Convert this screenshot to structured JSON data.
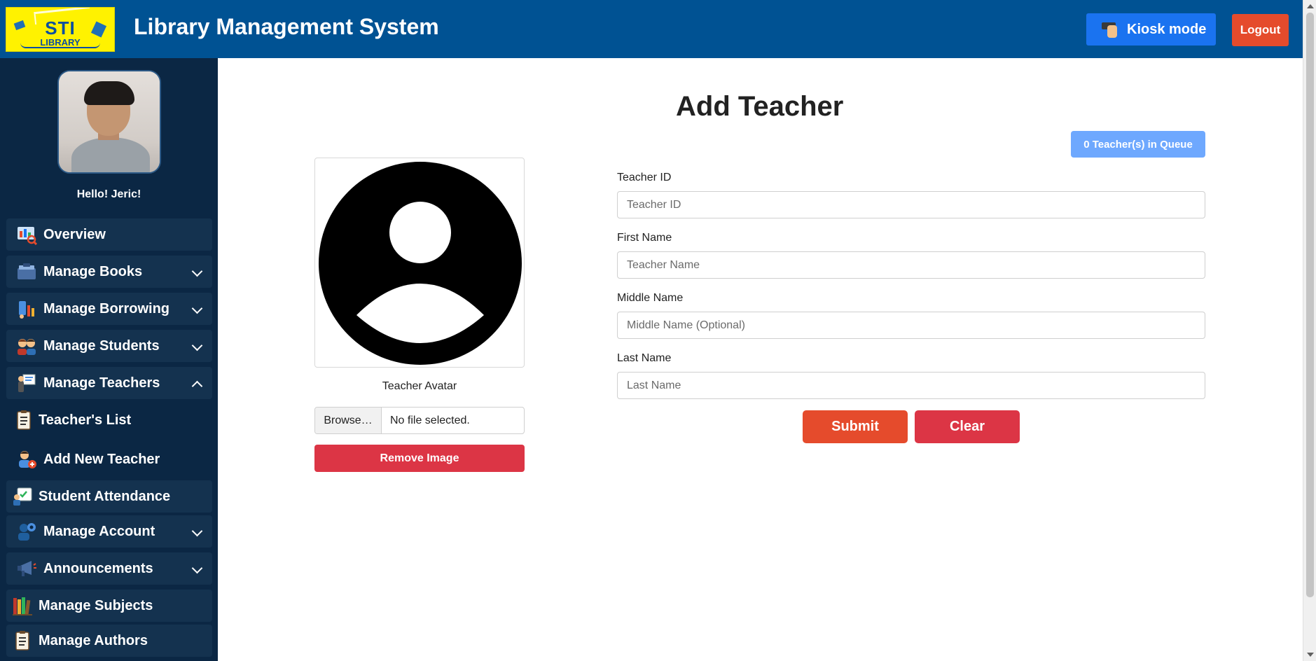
{
  "header": {
    "logo_text_main": "STI",
    "logo_text_sub": "LIBRARY",
    "title": "Library Management System",
    "kiosk_label": "Kiosk mode",
    "logout_label": "Logout"
  },
  "sidebar": {
    "greeting": "Hello! Jeric!",
    "items": [
      {
        "label": "Overview",
        "icon": "overview-icon",
        "expandable": false
      },
      {
        "label": "Manage Books",
        "icon": "books-icon",
        "expandable": true,
        "expanded": false
      },
      {
        "label": "Manage Borrowing",
        "icon": "borrowing-icon",
        "expandable": true,
        "expanded": false
      },
      {
        "label": "Manage Students",
        "icon": "students-icon",
        "expandable": true,
        "expanded": false
      },
      {
        "label": "Manage Teachers",
        "icon": "teachers-icon",
        "expandable": true,
        "expanded": true
      },
      {
        "label": "Teacher's List",
        "icon": "list-icon",
        "expandable": false
      },
      {
        "label": "Add New Teacher",
        "icon": "add-teacher-icon",
        "expandable": false
      },
      {
        "label": "Student Attendance",
        "icon": "attendance-icon",
        "expandable": false
      },
      {
        "label": "Manage Account",
        "icon": "account-icon",
        "expandable": true,
        "expanded": false
      },
      {
        "label": "Announcements",
        "icon": "megaphone-icon",
        "expandable": true,
        "expanded": false
      },
      {
        "label": "Manage Subjects",
        "icon": "subjects-icon",
        "expandable": false
      },
      {
        "label": "Manage Authors",
        "icon": "authors-icon",
        "expandable": false
      }
    ]
  },
  "main": {
    "page_title": "Add Teacher",
    "queue_badge": "0 Teacher(s) in Queue",
    "avatar_caption": "Teacher Avatar",
    "file_button": "Browse…",
    "file_status": "No file selected.",
    "remove_image": "Remove Image",
    "fields": {
      "teacher_id": {
        "label": "Teacher ID",
        "placeholder": "Teacher ID",
        "value": ""
      },
      "first_name": {
        "label": "First Name",
        "placeholder": "Teacher Name",
        "value": ""
      },
      "middle_name": {
        "label": "Middle Name",
        "placeholder": "Middle Name (Optional)",
        "value": ""
      },
      "last_name": {
        "label": "Last Name",
        "placeholder": "Last Name",
        "value": ""
      }
    },
    "submit_label": "Submit",
    "clear_label": "Clear"
  },
  "colors": {
    "header_bg": "#005293",
    "sidebar_bg": "#0b2744",
    "sidebar_item_bg": "#14324f",
    "kiosk_btn": "#1a73f0",
    "logout_btn": "#e54b2c",
    "submit_btn": "#e54b2c",
    "clear_btn": "#dc3545",
    "remove_btn": "#dc3545",
    "queue_badge": "#6ea8fe",
    "logo_bg": "#fff200"
  }
}
